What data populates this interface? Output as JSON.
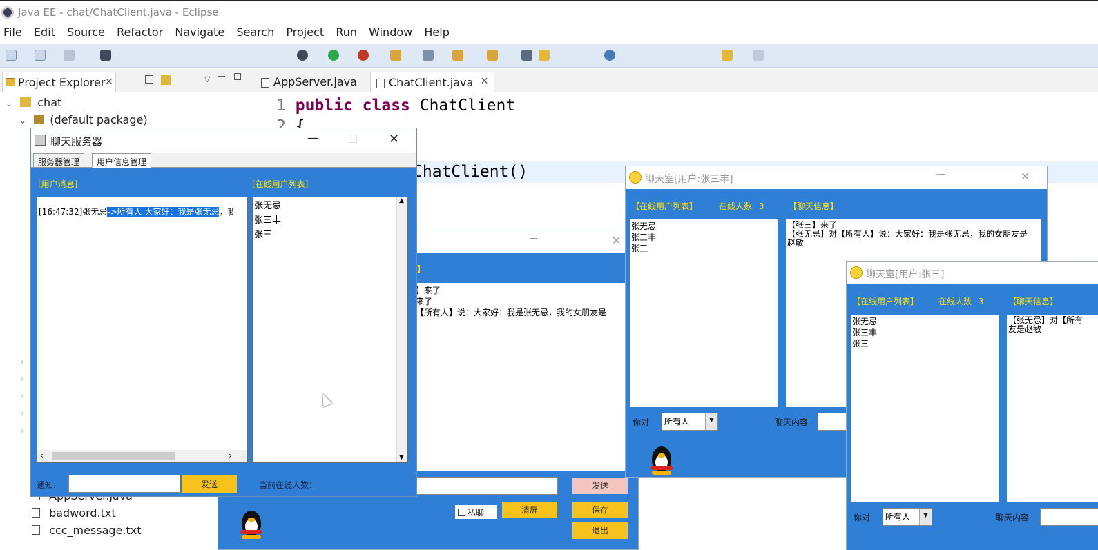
{
  "eclipse": {
    "title": "Java EE - chat/ChatClient.java - Eclipse",
    "menu": [
      "File",
      "Edit",
      "Source",
      "Refactor",
      "Navigate",
      "Search",
      "Project",
      "Run",
      "Window",
      "Help"
    ],
    "project_explorer": {
      "tab_label": "Project Explorer",
      "tree": {
        "project": "chat",
        "package": "(default package)",
        "files": [
          "AppServer.java",
          "badword.txt",
          "ccc_message.txt"
        ]
      }
    },
    "editor": {
      "tabs": [
        "AppServer.java",
        "ChatClient.java"
      ],
      "active_tab": "ChatClient.java",
      "lines": [
        {
          "num": "1",
          "kw": "public class",
          "rest": " ChatClient"
        },
        {
          "num": "2",
          "kw": "",
          "rest": "{"
        },
        {
          "num": "",
          "kw": "",
          "rest": "ChatClient()"
        }
      ]
    }
  },
  "server_window": {
    "title": "聊天服务器",
    "tabs": [
      "服务器管理",
      "用户信息管理"
    ],
    "user_messages_label": "[用户消息]",
    "online_list_label": "[在线用户列表]",
    "message_prefix": "[16:47:32]张无忌",
    "message_highlight": "->所有人 大家好：我是张无忌",
    "message_tail": "，我",
    "online_users": [
      "张无忌",
      "张三丰",
      "张三"
    ],
    "notice_label": "通知:",
    "notice_value": "",
    "send_label": "发送",
    "online_count_label": "当前在线人数："
  },
  "client_mid": {
    "header_label": "】",
    "messages": [
      "】来了",
      "来了",
      "【所有人】说：大家好：我是张无忌，我的女朋友是"
    ],
    "private_label": "私聊",
    "send_label": "发送",
    "clear_label": "清屏",
    "save_label": "保存",
    "exit_label": "退出"
  },
  "client_zsf": {
    "title": "聊天室[用户:张三丰]",
    "online_list_label": "【在线用户列表】",
    "online_count_label": "在线人数",
    "online_count": "3",
    "chat_info_label": "【聊天信息】",
    "users": [
      "张无忌",
      "张三丰",
      "张三"
    ],
    "messages": [
      "【张三】来了",
      "【张无忌】对【所有人】说：大家好：我是张无忌，我的女朋友是赵敏"
    ],
    "to_label": "你对",
    "to_value": "所有人",
    "content_label": "聊天内容"
  },
  "client_zs": {
    "title": "聊天室[用户:张三]",
    "online_list_label": "【在线用户列表】",
    "online_count_label": "在线人数",
    "online_count": "3",
    "chat_info_label": "【聊天信息】",
    "users": [
      "张无忌",
      "张三丰",
      "张三"
    ],
    "messages": [
      "【张无忌】对【所有",
      "友是赵敏"
    ],
    "to_label": "你对",
    "to_value": "所有人",
    "content_label": "聊天内容"
  },
  "colors": {
    "window_blue": "#2f7fd6",
    "label_yellow": "#ffe100",
    "button_yellow": "#f7c21b",
    "selection_blue": "#1673e0"
  }
}
